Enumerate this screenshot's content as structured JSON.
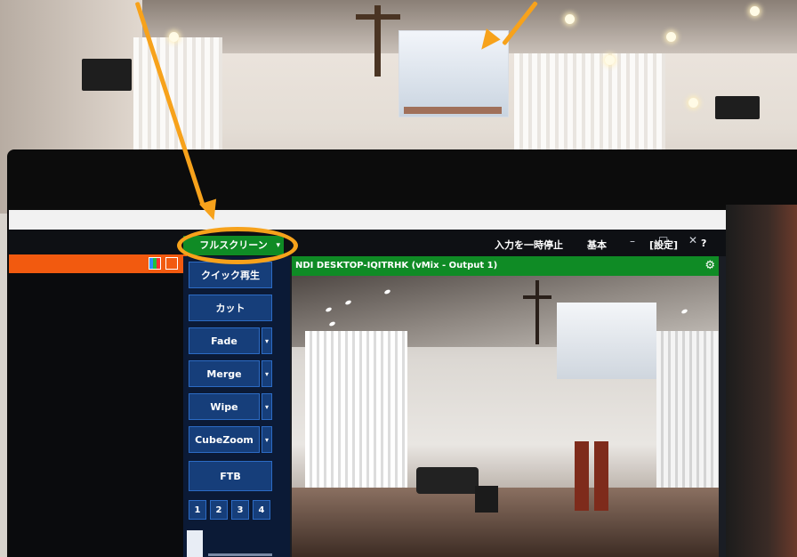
{
  "colors": {
    "accent_green": "#0f8b25",
    "accent_orange": "#f25a0f",
    "button_blue": "#163e7a",
    "annotation_orange": "#f7a21b"
  },
  "app": {
    "fullscreen_label": "フルスクリーン",
    "fullscreen_caret": "▾",
    "nav": {
      "pause_input": "入力を一時停止",
      "basic": "基本",
      "settings": "[設定]",
      "help": "?"
    },
    "window_controls": {
      "minimize": "–",
      "maximize": "□",
      "close": "✕"
    }
  },
  "transitions": {
    "quick_play": "クイック再生",
    "cut": "カット",
    "fade": "Fade",
    "merge": "Merge",
    "wipe": "Wipe",
    "cubezoom": "CubeZoom",
    "ftb": "FTB",
    "dropdown_glyph": "▾",
    "numbers": [
      "1",
      "2",
      "3",
      "4"
    ]
  },
  "output": {
    "title": "NDI DESKTOP-IQITRHK (vMix - Output 1)",
    "gear_glyph": "⚙"
  }
}
